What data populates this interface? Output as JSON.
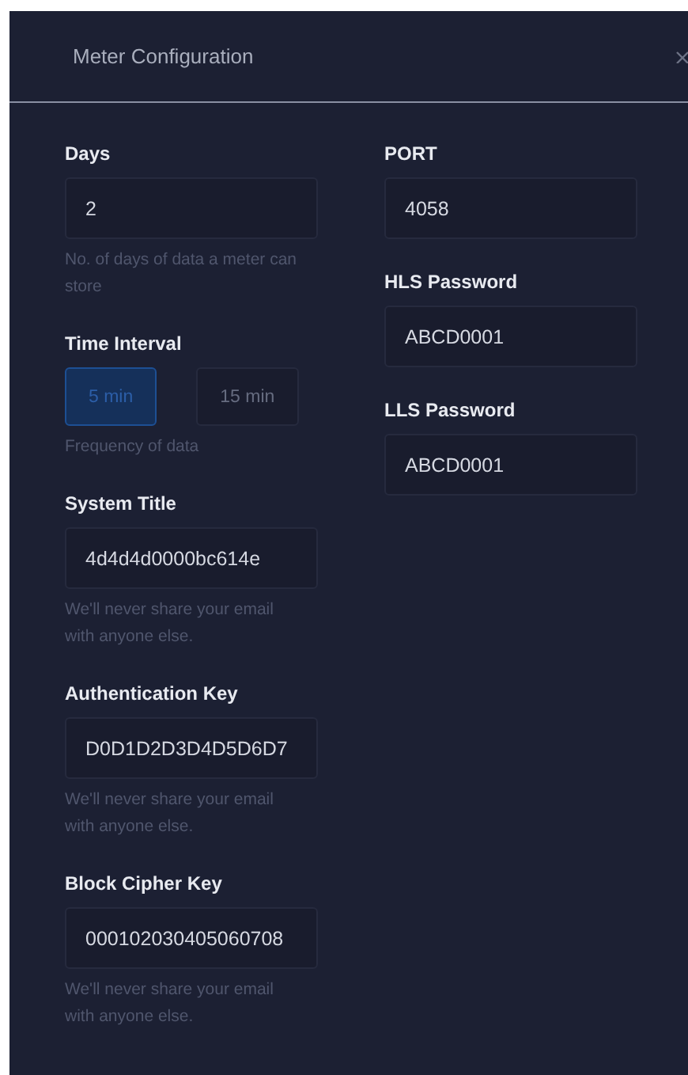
{
  "dialog": {
    "title": "Meter Configuration"
  },
  "left_fields": [
    {
      "kind": "input",
      "label": "Days",
      "value": "2",
      "hint_lines": [
        "No. of days of data a meter can",
        "store"
      ]
    },
    {
      "kind": "choice",
      "label": "Time Interval",
      "options": [
        {
          "label": "5 min",
          "selected": true
        },
        {
          "label": "15 min",
          "selected": false
        }
      ],
      "hint_lines": [
        "Frequency of data"
      ]
    },
    {
      "kind": "input",
      "label": "System Title",
      "value": "4d4d4d0000bc614e",
      "hint_lines": [
        "We'll never share your email",
        "with anyone else."
      ]
    },
    {
      "kind": "input",
      "label": "Authentication Key",
      "value": "D0D1D2D3D4D5D6D7",
      "hint_lines": [
        "We'll never share your email",
        "with anyone else."
      ]
    },
    {
      "kind": "input",
      "label": "Block Cipher Key",
      "value": "000102030405060708",
      "hint_lines": [
        "We'll never share your email",
        "with anyone else."
      ]
    }
  ],
  "right_fields": [
    {
      "kind": "input",
      "label": "PORT",
      "value": "4058"
    },
    {
      "kind": "input",
      "label": "HLS Password",
      "value": "ABCD0001"
    },
    {
      "kind": "input",
      "label": "LLS Password",
      "value": "ABCD0001"
    }
  ]
}
